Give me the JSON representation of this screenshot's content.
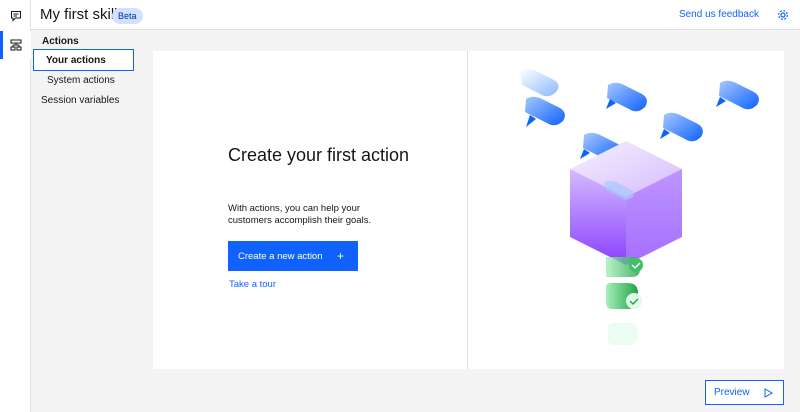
{
  "app": {
    "title": "My first skill",
    "badge": "Beta",
    "feedback_link": "Send us feedback"
  },
  "rail": {
    "items": [
      {
        "icon": "chat-icon",
        "active": false
      },
      {
        "icon": "actions-icon",
        "active": true
      }
    ]
  },
  "nav": {
    "heading": "Actions",
    "items": [
      {
        "label": "Your actions",
        "selected": true
      },
      {
        "label": "System actions",
        "selected": false
      },
      {
        "label": "Session variables",
        "selected": false
      }
    ]
  },
  "main": {
    "heading": "Create your first action",
    "description": "With actions, you can help your customers accomplish their goals.",
    "primary_button": "Create a new action",
    "primary_button_icon": "+",
    "tour_link": "Take a tour"
  },
  "footer": {
    "preview_button": "Preview"
  },
  "colors": {
    "accent": "#0f62fe",
    "badge_bg": "#d0e2ff",
    "cube": "#a56eff",
    "check": "#42be65"
  }
}
